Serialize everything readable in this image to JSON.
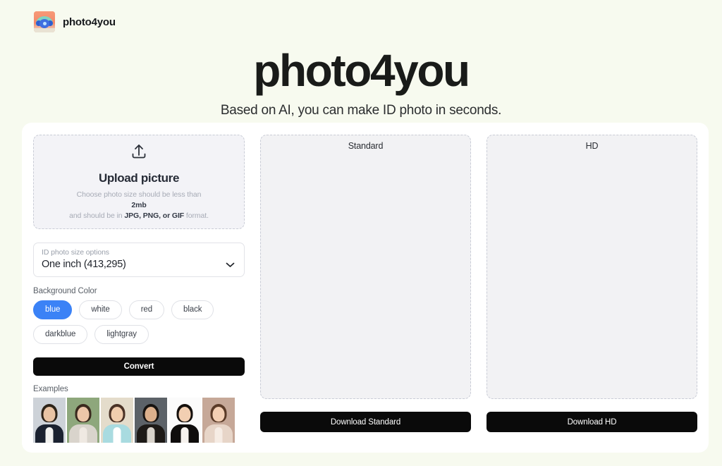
{
  "brand": {
    "name": "photo4you",
    "logo_icon": "flower-photo-logo-icon"
  },
  "hero": {
    "title": "photo4you",
    "subtitle": "Based on AI, you can make ID photo in seconds."
  },
  "upload": {
    "icon": "upload-arrow-icon",
    "title": "Upload picture",
    "hint_line1": "Choose photo size should be less than",
    "hint_size": "2mb",
    "hint_line3_prefix": "and should be in ",
    "hint_formats": "JPG, PNG, or GIF",
    "hint_line3_suffix": " format."
  },
  "size_select": {
    "label": "ID photo size options",
    "value": "One inch (413,295)",
    "chevron_icon": "chevron-down-icon"
  },
  "background_color": {
    "label": "Background Color",
    "selected": "blue",
    "accent_hex": "#3b82f6",
    "options": [
      {
        "label": "blue"
      },
      {
        "label": "white"
      },
      {
        "label": "red"
      },
      {
        "label": "black"
      },
      {
        "label": "darkblue"
      },
      {
        "label": "lightgray"
      }
    ]
  },
  "convert": {
    "label": "Convert"
  },
  "examples": {
    "label": "Examples",
    "items": [
      {
        "alt": "man in dark suit on light gray background",
        "bg": "#cdd2d8",
        "hair": "#2d2318",
        "skin": "#e8c3a4",
        "body": "#1b2230",
        "shirt": "#f2f2f0"
      },
      {
        "alt": "woman with long hair on green outdoor background",
        "bg": "#8ea77c",
        "hair": "#3a2a1e",
        "skin": "#ecc6a8",
        "body": "#d9d4cc",
        "shirt": "#efe9e2"
      },
      {
        "alt": "woman in light blue top on beige background",
        "bg": "#e4dccb",
        "hair": "#4a3226",
        "skin": "#f0cdae",
        "body": "#a9dbe0",
        "shirt": "#ffffff"
      },
      {
        "alt": "man in suit and tie on dark gray background",
        "bg": "#5c6268",
        "hair": "#171310",
        "skin": "#dcb08c",
        "body": "#1d1a17",
        "shirt": "#d8d3cb"
      },
      {
        "alt": "woman in black blazer on white background",
        "bg": "#fbfbfb",
        "hair": "#15100d",
        "skin": "#f2cfb2",
        "body": "#0f0d0c",
        "shirt": "#f6f2ee"
      },
      {
        "alt": "child on warm indoor background",
        "bg": "#c6a898",
        "hair": "#5a3a27",
        "skin": "#f3cfb4",
        "body": "#e7d5c8",
        "shirt": "#f6ece4"
      }
    ]
  },
  "previews": [
    {
      "title": "Standard",
      "download_label": "Download Standard"
    },
    {
      "title": "HD",
      "download_label": "Download HD"
    }
  ]
}
